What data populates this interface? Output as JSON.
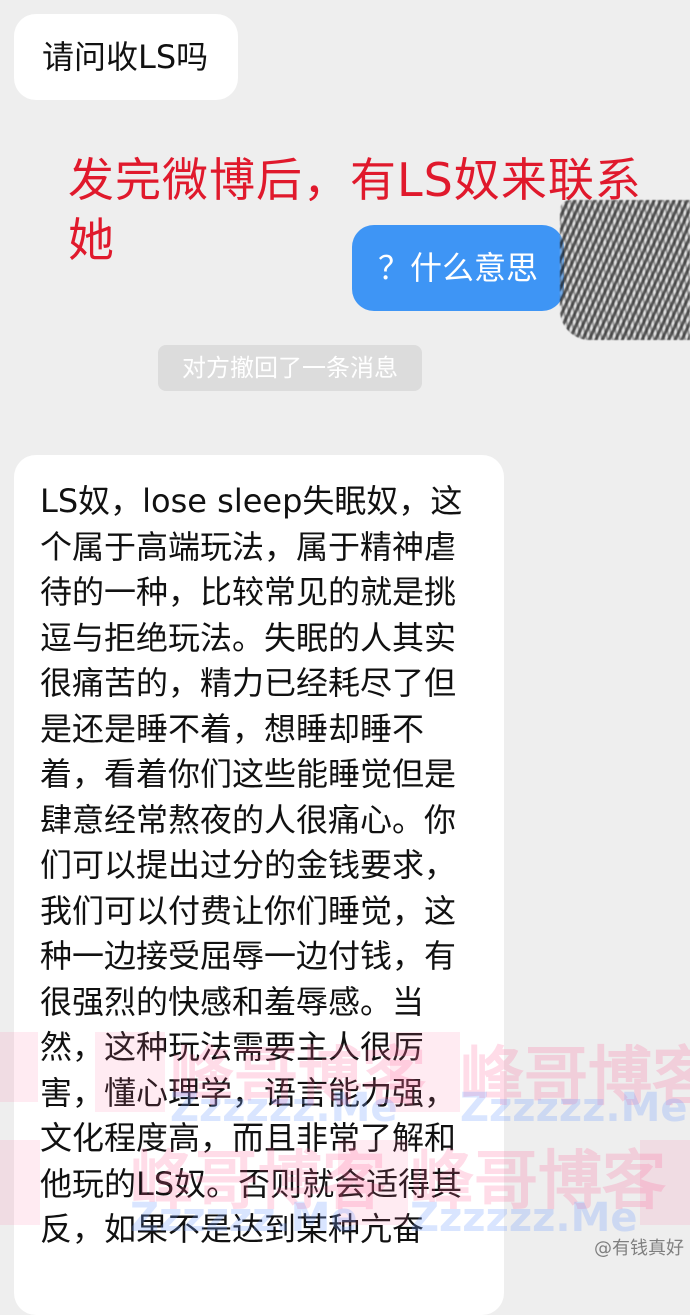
{
  "messages": {
    "incoming_1": "请问收LS吗",
    "outgoing_1": "？什么意思",
    "recall_notice": "对方撤回了一条消息",
    "incoming_2": "LS奴，lose sleep失眠奴，这个属于高端玩法，属于精神虐待的一种，比较常见的就是挑逗与拒绝玩法。失眠的人其实很痛苦的，精力已经耗尽了但是还是睡不着，想睡却睡不着，看着你们这些能睡觉但是肆意经常熬夜的人很痛心。你们可以提出过分的金钱要求，我们可以付费让你们睡觉，这种一边接受屈辱一边付钱，有很强烈的快感和羞辱感。当然，这种玩法需要主人很厉害，懂心理学，语言能力强，文化程度高，而且非常了解和他玩的LS奴。否则就会适得其反，如果不是达到某种亢奋"
  },
  "annotation": "发完微博后，有LS奴来联系她",
  "watermark": {
    "title": "峰哥博客",
    "url": "Zzzzzz.Me"
  },
  "weibo_tag": "@有钱真好"
}
